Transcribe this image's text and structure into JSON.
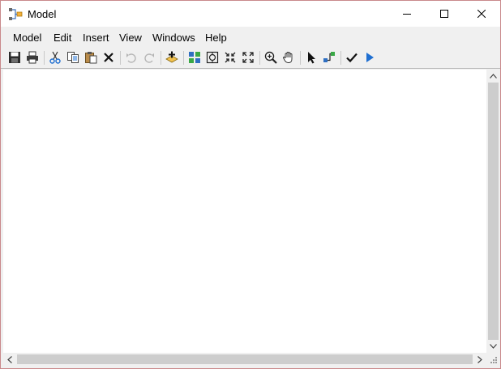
{
  "window": {
    "title": "Model",
    "border_color": "#c9898b"
  },
  "title_controls": {
    "minimize_icon": "minimize-icon",
    "maximize_icon": "maximize-icon",
    "close_icon": "close-icon"
  },
  "menu": {
    "items": [
      "Model",
      "Edit",
      "Insert",
      "View",
      "Windows",
      "Help"
    ]
  },
  "toolbar": {
    "buttons": [
      "save-icon",
      "print-icon",
      "cut-icon",
      "copy-icon",
      "paste-icon",
      "delete-icon",
      "undo-icon",
      "redo-icon",
      "add-data-icon",
      "auto-layout-icon",
      "full-extent-icon",
      "fit-selection-icon",
      "zoom-extent-icon",
      "zoom-in-icon",
      "pan-icon",
      "select-icon",
      "connect-icon",
      "validate-icon",
      "run-icon"
    ],
    "disabled": [
      "undo-icon",
      "redo-icon"
    ]
  },
  "colors": {
    "accent_blue": "#1f6fd1",
    "toolbar_bg": "#f0f0f0",
    "canvas_bg": "#ffffff",
    "scroll_thumb": "#cdcdcd"
  }
}
